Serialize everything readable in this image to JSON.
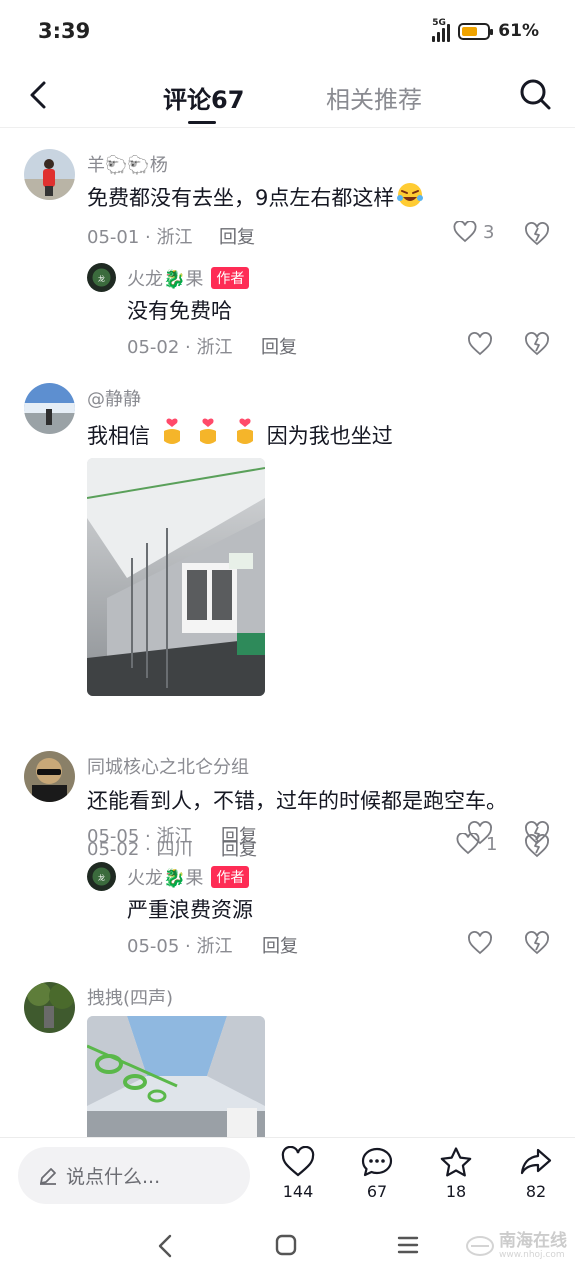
{
  "status": {
    "time": "3:39",
    "network": "5G",
    "battery_pct": "61%",
    "battery_level": 0.61
  },
  "header": {
    "tab_comments": "评论67",
    "tab_related": "相关推荐"
  },
  "comments": [
    {
      "user": "羊🐑🐑杨",
      "text": "免费都没有去坐，9点左右都这样",
      "date": "05-01 · 浙江",
      "reply": "回复",
      "likes": "3",
      "replies": [
        {
          "user": "火龙🐉果",
          "badge": "作者",
          "text": "没有免费哈",
          "date": "05-02 · 浙江",
          "reply": "回复"
        }
      ]
    },
    {
      "user": "@静静",
      "text_before": "我相信",
      "text_after": "因为我也坐过",
      "date": "05-02 · 四川",
      "reply": "回复",
      "likes": "1"
    },
    {
      "user": "同城核心之北仑分组",
      "text": "还能看到人，不错，过年的时候都是跑空车。",
      "date": "05-05 · 浙江",
      "reply": "回复",
      "replies": [
        {
          "user": "火龙🐉果",
          "badge": "作者",
          "text": "严重浪费资源",
          "date": "05-05 · 浙江",
          "reply": "回复"
        }
      ]
    },
    {
      "user": "拽拽(四声)"
    }
  ],
  "bottom": {
    "input_placeholder": "说点什么...",
    "likes": "144",
    "comments": "67",
    "favorites": "18",
    "shares": "82"
  },
  "watermark": {
    "text": "南海在线",
    "sub": "www.nhoj.com"
  },
  "colors": {
    "author_badge": "#fe2c55",
    "battery": "#f0a400",
    "muted_text": "#8a8b91"
  }
}
